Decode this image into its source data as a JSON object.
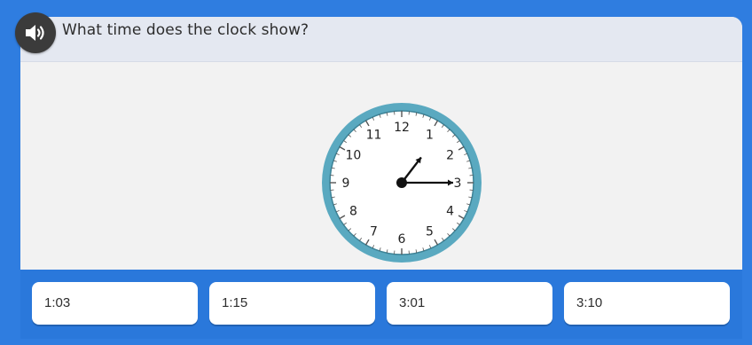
{
  "question": {
    "text": "What time does the clock show?",
    "audio_icon": "speaker-icon"
  },
  "clock": {
    "numbers": [
      "12",
      "1",
      "2",
      "3",
      "4",
      "5",
      "6",
      "7",
      "8",
      "9",
      "10",
      "11"
    ],
    "time_shown": "1:15",
    "hour_value": 1.25,
    "minute_value": 15,
    "rim_color": "#5aa9c0",
    "hand_color": "#111111"
  },
  "answers": [
    "1:03",
    "1:15",
    "3:01",
    "3:10"
  ],
  "colors": {
    "background": "#2f7de0",
    "card": "#f2f2f2",
    "question_bar": "#e4e8f1"
  }
}
